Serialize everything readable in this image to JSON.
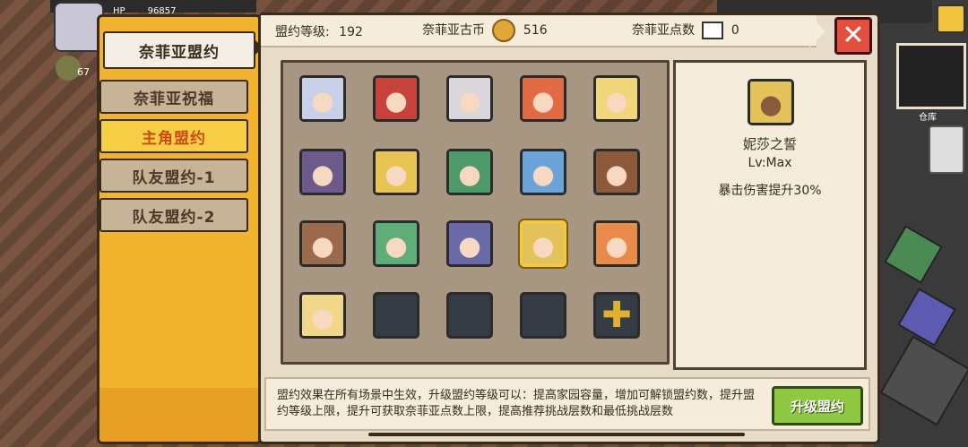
{
  "hud": {
    "hp_label": "HP",
    "hp_value": "96857",
    "level": "67",
    "warehouse": "仓库"
  },
  "tabs": [
    {
      "label": "奈菲亚盟约",
      "state": "active"
    },
    {
      "label": "奈菲亚祝福",
      "state": "normal"
    },
    {
      "label": "主角盟约",
      "state": "selected"
    },
    {
      "label": "队友盟约-1",
      "state": "normal"
    },
    {
      "label": "队友盟约-2",
      "state": "normal"
    }
  ],
  "header": {
    "level_label": "盟约等级:",
    "level_value": "192",
    "coin_label": "奈菲亚古币",
    "coin_value": "516",
    "points_label": "奈菲亚点数",
    "points_value": "0",
    "close_icon": "close-x-icon"
  },
  "grid": {
    "rows": [
      [
        {
          "name": "silver-hair-girl",
          "color": "#c8d0e8"
        },
        {
          "name": "red-hair-girl",
          "color": "#c8413a"
        },
        {
          "name": "white-hair-boy",
          "color": "#d9d6dc"
        },
        {
          "name": "orange-hair-girl",
          "color": "#e26a45"
        },
        {
          "name": "blonde-elf",
          "color": "#f1d57a"
        }
      ],
      [
        {
          "name": "purple-hood-girl",
          "color": "#6b5a8a"
        },
        {
          "name": "blonde-boy",
          "color": "#e8c453"
        },
        {
          "name": "green-hair-boy",
          "color": "#4f9a6a"
        },
        {
          "name": "blue-hair-elf",
          "color": "#6aa3d8"
        },
        {
          "name": "bearded-warrior",
          "color": "#8a5a3a"
        }
      ],
      [
        {
          "name": "brown-hair-girl",
          "color": "#9a6a4a"
        },
        {
          "name": "green-hair-girl",
          "color": "#5fae79"
        },
        {
          "name": "purple-skin-elf",
          "color": "#6a6aa8"
        },
        {
          "name": "dark-elf-girl",
          "color": "#e3c25a",
          "selected": true
        },
        {
          "name": "horned-girl",
          "color": "#e88a4a"
        }
      ],
      [
        {
          "name": "blonde-pigtail-girl",
          "color": "#f2d68a"
        },
        {
          "empty": true
        },
        {
          "empty": true
        },
        {
          "empty": true
        },
        {
          "plus": true,
          "icon": "plus-icon"
        }
      ]
    ]
  },
  "detail": {
    "name": "妮莎之誓",
    "level": "Lv:Max",
    "bonus": "暴击伤害提升30%",
    "face_color": "#e3c25a"
  },
  "footer": {
    "text": "盟约效果在所有场景中生效，升级盟约等级可以：提高家园容量，增加可解锁盟约数，提升盟约等级上限，提升可获取奈菲亚点数上限，提高推荐挑战层数和最低挑战层数",
    "upgrade_label": "升级盟约"
  }
}
